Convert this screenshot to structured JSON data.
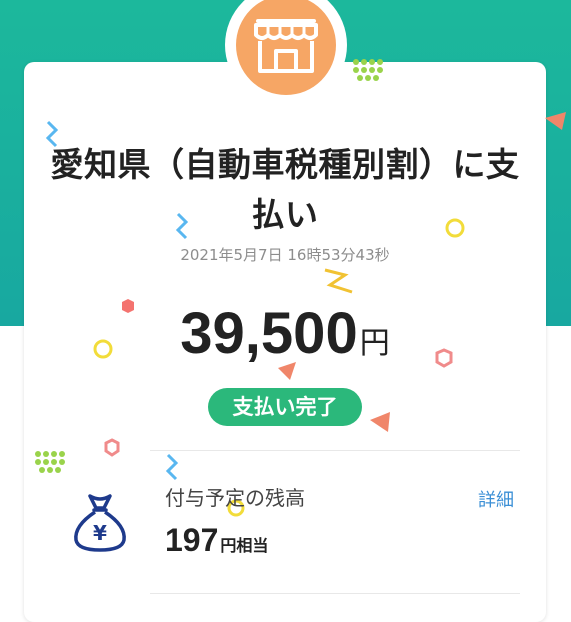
{
  "payment": {
    "title_line1": "愛知県（自動車税種別割）に支",
    "title_line2": "払い",
    "timestamp": "2021年5月7日 16時53分43秒",
    "amount": "39,500",
    "currency_unit": "円",
    "status": "支払い完了"
  },
  "points": {
    "label": "付与予定の残高",
    "detail_link": "詳細",
    "value": "197",
    "unit": "円相当"
  },
  "icons": {
    "header": "shop-icon",
    "points": "money-bag-yen-icon"
  },
  "colors": {
    "header_gradient_top": "#1cb89c",
    "header_gradient_bottom": "#18a8a0",
    "shop_circle": "#f6a665",
    "status_badge": "#2bb87b",
    "link": "#3b8fd6",
    "bag_icon": "#1e3a8c"
  }
}
